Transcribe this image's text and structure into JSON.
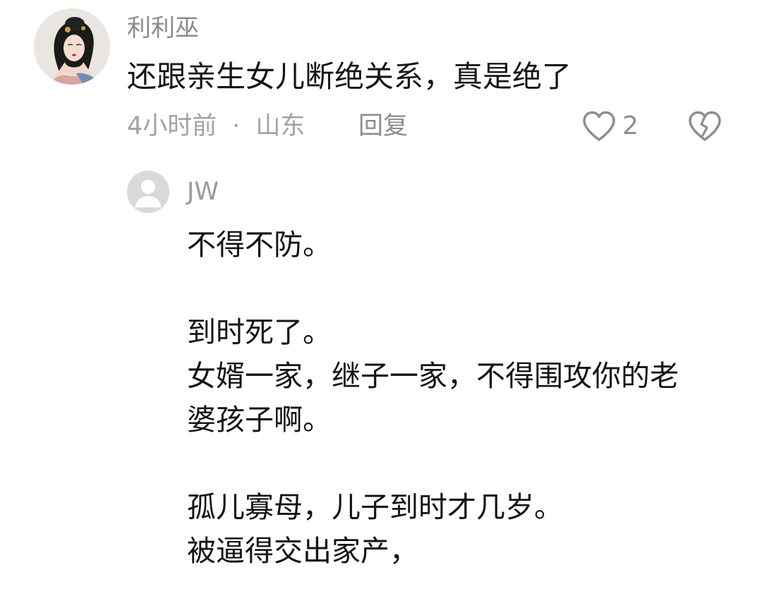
{
  "comment": {
    "username": "利利巫",
    "text": "还跟亲生女儿断绝关系，真是绝了",
    "time": "4小时前",
    "separator": "·",
    "location": "山东",
    "reply_label": "回复",
    "like_count": "2",
    "icons": {
      "like": "heart-outline-icon",
      "dislike": "broken-heart-icon"
    }
  },
  "reply": {
    "username": "JW",
    "lines": [
      "不得不防。",
      "",
      "到时死了。",
      "女婿一家，继子一家，不得围攻你的老",
      "婆孩子啊。",
      "",
      "孤儿寡母，儿子到时才几岁。",
      "被逼得交出家产，"
    ]
  },
  "colors": {
    "text_primary": "#151515",
    "text_secondary": "#8b8b8b",
    "icon": "#8e8e8e",
    "avatar_placeholder": "#dcdcdc"
  }
}
